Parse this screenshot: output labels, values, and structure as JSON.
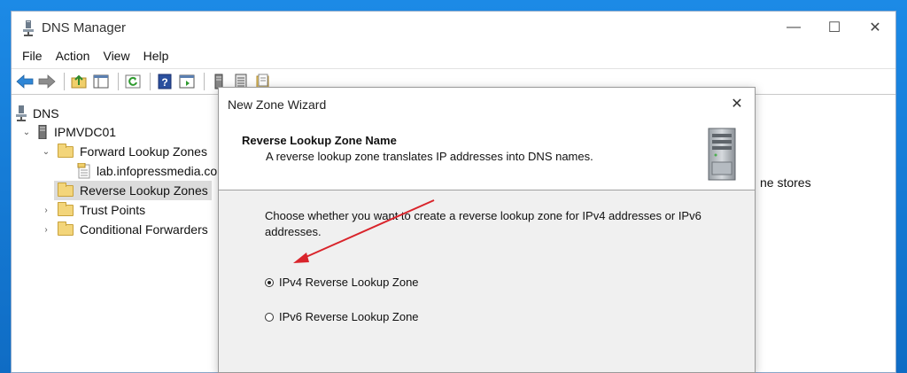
{
  "window": {
    "title": "DNS Manager",
    "controls": {
      "minimize": "—",
      "maximize": "☐",
      "close": "✕"
    }
  },
  "menu": [
    "File",
    "Action",
    "View",
    "Help"
  ],
  "toolbar": {
    "icons": [
      "back-arrow-icon",
      "forward-arrow-icon",
      "up-folder-icon",
      "show-hide-tree-icon",
      "refresh-icon",
      "help-icon",
      "properties-icon",
      "server-icon",
      "list-icon",
      "new-zone-icon"
    ]
  },
  "tree": {
    "root": "DNS",
    "server": "IPMVDC01",
    "items": [
      {
        "label": "Forward Lookup Zones"
      },
      {
        "label": "lab.infopressmedia.com"
      },
      {
        "label": "Reverse Lookup Zones"
      },
      {
        "label": "Trust Points"
      },
      {
        "label": "Conditional Forwarders"
      }
    ]
  },
  "right_pane": {
    "fragment": "ne stores"
  },
  "dialog": {
    "title": "New Zone Wizard",
    "close": "✕",
    "header_title": "Reverse Lookup Zone Name",
    "header_desc": "A reverse lookup zone translates IP addresses into DNS names.",
    "body": "Choose whether you want to create a reverse lookup zone for IPv4 addresses or IPv6 addresses.",
    "options": [
      {
        "label": "IPv4 Reverse Lookup Zone",
        "selected": true
      },
      {
        "label": "IPv6 Reverse Lookup Zone",
        "selected": false
      }
    ]
  },
  "colors": {
    "desktop": "#1a7fd8",
    "annotation_arrow": "#d9242b",
    "selection": "#dcdcdc"
  }
}
